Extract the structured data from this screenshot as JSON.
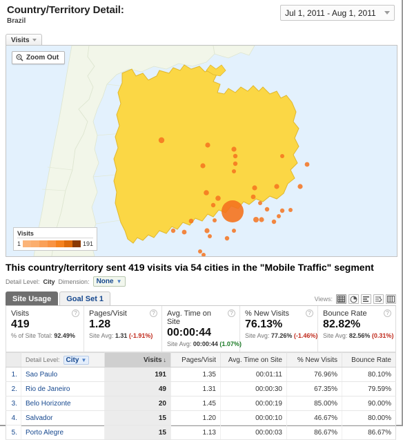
{
  "header": {
    "title": "Country/Territory Detail:",
    "subtitle": "Brazil",
    "date_range": "Jul 1, 2011 - Aug 1, 2011"
  },
  "map": {
    "metric_tab_label": "Visits",
    "zoom_out_label": "Zoom Out",
    "zoom_out_icon": "magnifier-minus-icon",
    "legend": {
      "title": "Visits",
      "min": "1",
      "max": "191",
      "colors": [
        "#FBB479",
        "#FBAE6E",
        "#FAA058",
        "#F99343",
        "#F5821F",
        "#DD6B0C",
        "#8A3A05"
      ]
    },
    "region_fill": "#FBD745",
    "ocean_fill": "#E3F1FD",
    "land_fill": "#F2F6E9",
    "marker_color": "#F4731E"
  },
  "summary": {
    "headline": "This country/territory sent 419 visits via 54 cities in the \"Mobile Traffic\" segment",
    "detail_level_label": "Detail Level:",
    "detail_level_value": "City",
    "dimension_label": "Dimension:",
    "dimension_value": "None"
  },
  "panel": {
    "tabs": [
      {
        "label": "Site Usage",
        "active": true
      },
      {
        "label": "Goal Set 1",
        "active": false
      }
    ],
    "views_label": "Views:",
    "view_icons": [
      {
        "name": "table-view-icon",
        "selected": true
      },
      {
        "name": "pie-chart-view-icon",
        "selected": false
      },
      {
        "name": "bar-chart-view-icon",
        "selected": false
      },
      {
        "name": "comparison-view-icon",
        "selected": false
      },
      {
        "name": "pivot-view-icon",
        "selected": false
      }
    ],
    "metrics": [
      {
        "name": "Visits",
        "value": "419",
        "sub_prefix": "% of Site Total:",
        "sub_value": "92.49%",
        "delta": "",
        "delta_sign": ""
      },
      {
        "name": "Pages/Visit",
        "value": "1.28",
        "sub_prefix": "Site Avg:",
        "sub_value": "1.31",
        "delta": "(-1.91%)",
        "delta_sign": "neg"
      },
      {
        "name": "Avg. Time on Site",
        "value": "00:00:44",
        "sub_prefix": "Site Avg:",
        "sub_value": "00:00:44",
        "delta": "(1.07%)",
        "delta_sign": "pos"
      },
      {
        "name": "% New Visits",
        "value": "76.13%",
        "sub_prefix": "Site Avg:",
        "sub_value": "77.26%",
        "delta": "(-1.46%)",
        "delta_sign": "neg"
      },
      {
        "name": "Bounce Rate",
        "value": "82.82%",
        "sub_prefix": "Site Avg:",
        "sub_value": "82.56%",
        "delta": "(0.31%)",
        "delta_sign": "neg"
      }
    ]
  },
  "table": {
    "detail_level_label": "Detail Level:",
    "detail_level_value": "City",
    "columns": [
      "Visits",
      "Pages/Visit",
      "Avg. Time on Site",
      "% New Visits",
      "Bounce Rate"
    ],
    "sorted_column": "Visits",
    "sort_direction": "desc",
    "rows": [
      {
        "index": "1.",
        "city": "Sao Paulo",
        "visits": "191",
        "pages_visit": "1.35",
        "avg_time": "00:01:11",
        "new_visits": "76.96%",
        "bounce_rate": "80.10%"
      },
      {
        "index": "2.",
        "city": "Rio de Janeiro",
        "visits": "49",
        "pages_visit": "1.31",
        "avg_time": "00:00:30",
        "new_visits": "67.35%",
        "bounce_rate": "79.59%"
      },
      {
        "index": "3.",
        "city": "Belo Horizonte",
        "visits": "20",
        "pages_visit": "1.45",
        "avg_time": "00:00:19",
        "new_visits": "85.00%",
        "bounce_rate": "90.00%"
      },
      {
        "index": "4.",
        "city": "Salvador",
        "visits": "15",
        "pages_visit": "1.20",
        "avg_time": "00:00:10",
        "new_visits": "46.67%",
        "bounce_rate": "80.00%"
      },
      {
        "index": "5.",
        "city": "Porto Alegre",
        "visits": "15",
        "pages_visit": "1.13",
        "avg_time": "00:00:03",
        "new_visits": "86.67%",
        "bounce_rate": "86.67%"
      }
    ]
  }
}
